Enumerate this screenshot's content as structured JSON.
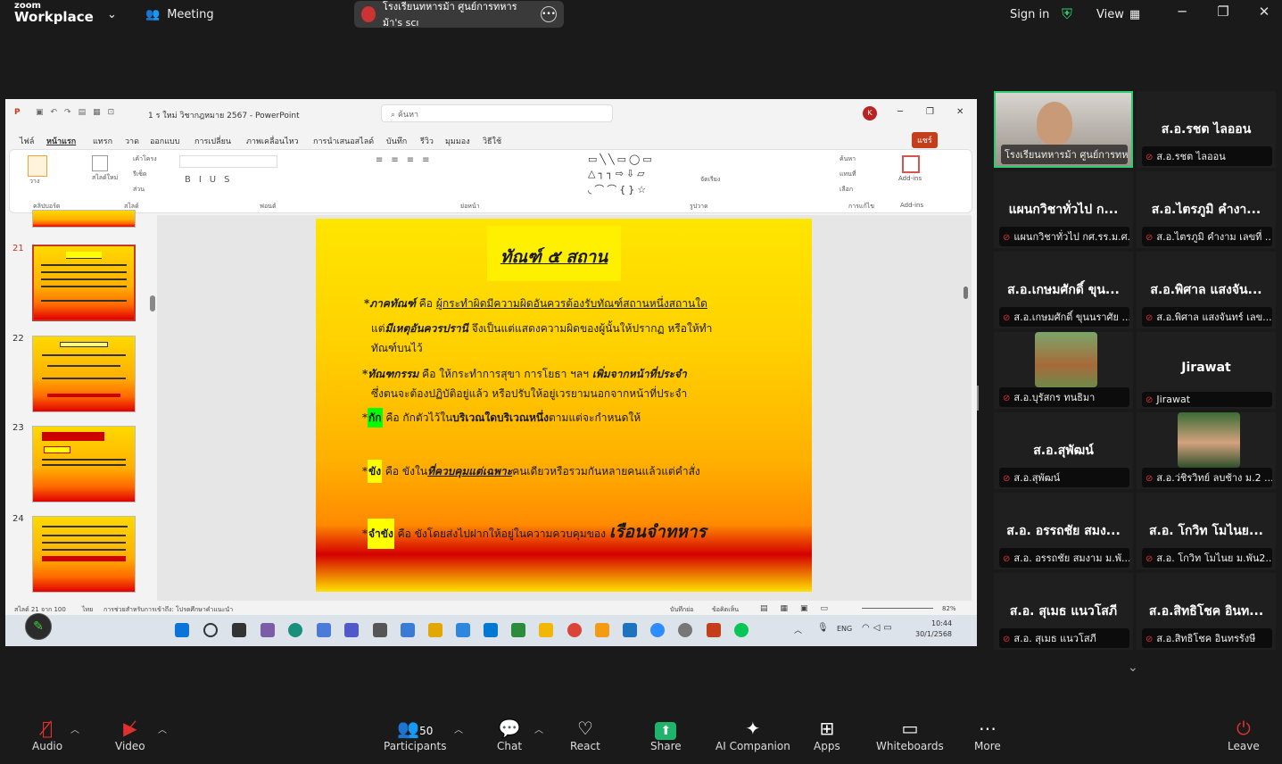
{
  "zoom": {
    "logo_line1": "zoom",
    "logo_line2": "Workplace",
    "meeting_label": "Meeting",
    "share_title": "โรงเรียนทหารม้า ศูนย์การทหารม้า's scı",
    "signin": "Sign in",
    "view": "View"
  },
  "ppt": {
    "title": "1 ร ใหม่ วิชากฎหมาย 2567  -  PowerPoint",
    "search": "ค้นหา",
    "user_initial": "K",
    "menu": [
      "ไฟล์",
      "หน้าแรก",
      "แทรก",
      "วาด",
      "ออกแบบ",
      "การเปลี่ยน",
      "ภาพเคลื่อนไหว",
      "การนำเสนอสไลด์",
      "บันทึก",
      "รีวิว",
      "มุมมอง",
      "วิธีใช้"
    ],
    "share_btn": "แชร์",
    "ribbon_groups": [
      "คลิปบอร์ด",
      "สไลด์",
      "ฟอนต์",
      "ย่อหน้า",
      "รูปวาด",
      "การแก้ไข",
      "Add-ins"
    ],
    "ribbon_items": [
      "วาง",
      "สไลด์ใหม่",
      "เค้าโครง",
      "รีเซ็ต",
      "ส่วน",
      "จัดเรียง",
      "ค้นหา",
      "แทนที่",
      "เลือก",
      "Add-ins"
    ],
    "slide_numbers": [
      "21",
      "22",
      "23",
      "24"
    ],
    "status_slide": "สไลด์ 21 จาก 100",
    "status_lang": "ไทย",
    "status_access": "การช่วยสำหรับการเข้าถึง: โปรดศึกษาคำแนะนำ",
    "status_notes": "บันทึกย่อ",
    "status_comments": "ข้อคิดเห็น",
    "zoom_pct": "82%",
    "time": "10:44",
    "date": "30/1/2568",
    "lang": "ENG"
  },
  "slide": {
    "title": "ทัณฑ์ ๕ สถาน",
    "l1_a": "*ภาคทัณฑ์",
    "l1_b": " คือ ",
    "l1_c": "ผู้กระทำผิดมีความผิดอันควรต้องรับทัณฑ์สถานหนึ่งสถานใด",
    "l2_a": "แต่",
    "l2_b": "มีเหตุอันควรปรานี",
    "l2_c": " จึงเป็นแต่แสดงความผิดของผู้นั้นให้ปรากฏ หรือให้ทำ",
    "l3": "ทัณฑ์บนไว้",
    "l4_a": "*ทัณฑกรรม",
    "l4_b": " คือ ให้กระทำการสุขา การโยธา ฯลฯ ",
    "l4_c": "เพิ่มจากหน้าที่ประจำ",
    "l5": "ซึ่งตนจะต้องปฏิบัติอยู่แล้ว หรือปรับให้อยู่เวรยามนอกจากหน้าที่ประจำ",
    "l6_a": "*",
    "l6_b": "กัก",
    "l6_c": " คือ กักตัวไว้ใน",
    "l6_d": "บริเวณใดบริเวณหนึ่ง",
    "l6_e": "ตามแต่จะกำหนดให้",
    "l7_a": "*",
    "l7_b": "ขัง",
    "l7_c": " คือ ขังใน",
    "l7_d": "ที่ควบคุมแต่เฉพาะ",
    "l7_e": "คนเดียวหรือรวมกันหลายคนแล้วแต่คำสั่ง",
    "l8_a": "*",
    "l8_b": "จำขัง",
    "l8_c": " คือ ขังโดยส่งไปฝากให้อยู่ในความควบคุมของ ",
    "l8_d": "เรือนจำทหาร"
  },
  "gallery": [
    {
      "name": "",
      "label": "โรงเรียนทหารม้า ศูนย์การทห...",
      "video": true
    },
    {
      "name": "ส.อ.รชต ไลออน",
      "label": "ส.อ.รชต ไลออน"
    },
    {
      "name": "แผนกวิชาทั่วไป ก...",
      "label": "แผนกวิชาทั่วไป กศ.รร.ม.ศ..."
    },
    {
      "name": "ส.อ.ไตรภูมิ คำงา...",
      "label": "ส.อ.ไตรภูมิ คำงาม เลขที่ ..."
    },
    {
      "name": "ส.อ.เกษมศักดิ์ ขุน...",
      "label": "ส.อ.เกษมศักดิ์ ขุนนราศัย ..."
    },
    {
      "name": "ส.อ.พิศาล แสงจัน...",
      "label": "ส.อ.พิศาล แสงจันทร์ เลข..."
    },
    {
      "name": "",
      "label": "ส.อ.บุรัสกร ทนธิมา",
      "photo": "horse"
    },
    {
      "name": "Jirawat",
      "label": "Jirawat"
    },
    {
      "name": "ส.อ.สุพัฒน์",
      "label": "ส.อ.สุพัฒน์"
    },
    {
      "name": "",
      "label": "ส.อ.ว่ชิรวิทย์ ลบช้าง ม.2 ...",
      "photo": "person"
    },
    {
      "name": "ส.อ. อรรถชัย สมง...",
      "label": "ส.อ. อรรถชัย สมงาม ม.พั..."
    },
    {
      "name": "ส.อ. โกวิท โมไนย...",
      "label": "ส.อ. โกวิท โมไนย ม.พัน2..."
    },
    {
      "name": "ส.อ. สุเมธ แนวโสภี",
      "label": "ส.อ. สุเมธ แนวโสภี"
    },
    {
      "name": "ส.อ.สิทธิโชค อินท...",
      "label": "ส.อ.สิทธิโชค อินทรรังษี"
    }
  ],
  "toolbar": {
    "audio": "Audio",
    "video": "Video",
    "participants": "Participants",
    "participants_count": "50",
    "chat": "Chat",
    "react": "React",
    "share": "Share",
    "ai": "AI Companion",
    "apps": "Apps",
    "whiteboards": "Whiteboards",
    "more": "More",
    "leave": "Leave"
  }
}
